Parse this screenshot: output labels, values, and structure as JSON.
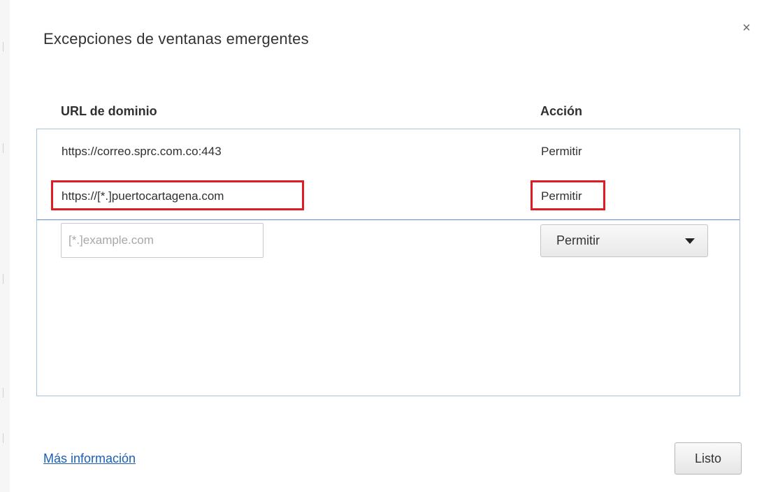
{
  "dialog": {
    "title": "Excepciones de ventanas emergentes",
    "close_label": "×"
  },
  "table": {
    "headers": {
      "url": "URL de dominio",
      "action": "Acción"
    },
    "rows": [
      {
        "url": "https://correo.sprc.com.co:443",
        "action": "Permitir",
        "highlighted": false
      },
      {
        "url": "https://[*.]puertocartagena.com",
        "action": "Permitir",
        "highlighted": true
      }
    ],
    "new_entry": {
      "placeholder": "[*.]example.com",
      "value": "",
      "action_selected": "Permitir"
    }
  },
  "footer": {
    "more_info_label": "Más información",
    "done_label": "Listo"
  },
  "colors": {
    "highlight": "#e01b24",
    "link": "#1a5fb4",
    "list_border": "#a4c2e4"
  },
  "icons": {
    "close": "close-icon",
    "dropdown": "chevron-down-icon"
  }
}
